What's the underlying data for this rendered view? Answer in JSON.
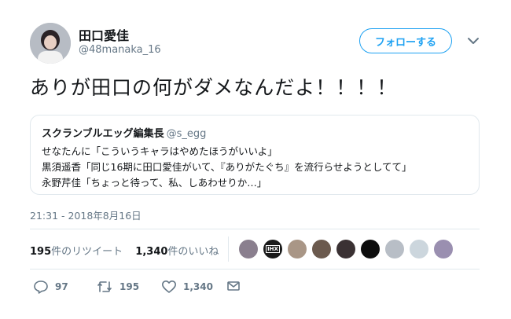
{
  "tweet": {
    "author_name": "田口愛佳",
    "author_handle": "@48manaka_16",
    "follow_label": "フォローする",
    "text": "ありが田口の何がダメなんだよ！！！！",
    "timestamp": "21:31 - 2018年8月16日"
  },
  "quote": {
    "name": "スクランブルエッグ編集長",
    "handle": "@s_egg",
    "lines": [
      "せなたんに「こういうキャラはやめたほうがいいよ」",
      "黒須遥香「同じ16期に田口愛佳がいて、『ありがたぐち』を流行らせようとしてて」",
      "永野芹佳「ちょっと待って、私、しあわせりか…」"
    ]
  },
  "stats": {
    "retweets_count": "195",
    "retweets_label": "件のリツイート",
    "likes_count": "1,340",
    "likes_label": "件のいいね"
  },
  "actions": {
    "reply_count": "97",
    "retweet_count": "195",
    "like_count": "1,340"
  },
  "likers": [
    {
      "color": "#8a7f8e"
    },
    {
      "color": "#1a1a1a",
      "label": "IHX"
    },
    {
      "color": "#a99686"
    },
    {
      "color": "#6b5a4e"
    },
    {
      "color": "#3a3133"
    },
    {
      "color": "#0d0d0d"
    },
    {
      "color": "#b8bec6"
    },
    {
      "color": "#ccd6dd"
    },
    {
      "color": "#9a8fb0"
    }
  ],
  "colors": {
    "accent": "#1da1f2",
    "secondary_text": "#657786",
    "border": "#e1e8ed"
  }
}
